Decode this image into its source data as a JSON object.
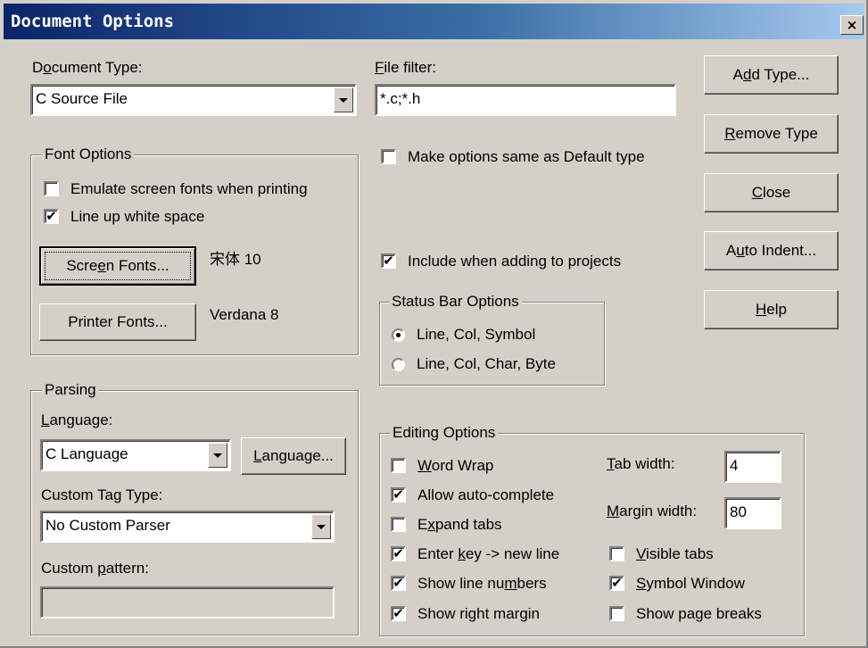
{
  "dialog": {
    "title": "Document Options",
    "close_glyph": "×"
  },
  "doc_type": {
    "label": "Document Type:",
    "underline": "o",
    "value": "C Source File"
  },
  "file_filter": {
    "label": "File filter:",
    "underline": "F",
    "value": "*.c;*.h"
  },
  "buttons": {
    "add_type": "Add Type...",
    "remove_type": "Remove Type",
    "close": "Close",
    "auto_indent": "Auto Indent...",
    "help": "Help"
  },
  "make_same": {
    "label": "Make options same as Default type",
    "checked": false
  },
  "include_projects": {
    "label": "Include when adding to projects",
    "checked": true
  },
  "font_options": {
    "title": "Font Options",
    "emulate": {
      "label": "Emulate screen fonts when printing",
      "checked": false
    },
    "lineup": {
      "label": "Line up white space",
      "checked": true
    },
    "screen_fonts_button": "Screen Fonts...",
    "screen_font": "宋体 10",
    "printer_fonts_button": "Printer Fonts...",
    "printer_font": "Verdana 8"
  },
  "status_bar": {
    "title": "Status Bar Options",
    "options": [
      {
        "label": "Line, Col, Symbol",
        "selected": true
      },
      {
        "label": "Line, Col, Char, Byte",
        "selected": false
      }
    ]
  },
  "parsing": {
    "title": "Parsing",
    "language_label": "Language:",
    "language_value": "C Language",
    "language_button": "Language...",
    "custom_tag_label": "Custom Tag Type:",
    "custom_tag_value": "No Custom Parser",
    "custom_pattern_label": "Custom pattern:",
    "custom_pattern_value": ""
  },
  "editing": {
    "title": "Editing Options",
    "word_wrap": {
      "label": "Word Wrap",
      "checked": false
    },
    "auto_complete": {
      "label": "Allow auto-complete",
      "checked": true
    },
    "expand_tabs": {
      "label": "Expand tabs",
      "checked": false
    },
    "enter_key": {
      "label": "Enter key -> new line",
      "checked": true
    },
    "line_numbers": {
      "label": "Show line numbers",
      "checked": true
    },
    "right_margin": {
      "label": "Show right margin",
      "checked": true
    },
    "tab_width_label": "Tab width:",
    "tab_width": "4",
    "margin_width_label": "Margin width:",
    "margin_width": "80",
    "visible_tabs": {
      "label": "Visible tabs",
      "checked": false
    },
    "symbol_window": {
      "label": "Symbol Window",
      "checked": true
    },
    "page_breaks": {
      "label": "Show page breaks",
      "checked": false
    }
  },
  "colors": {
    "title_start": "#0a246a",
    "title_end": "#a6caf0",
    "face": "#d4d0c8"
  }
}
